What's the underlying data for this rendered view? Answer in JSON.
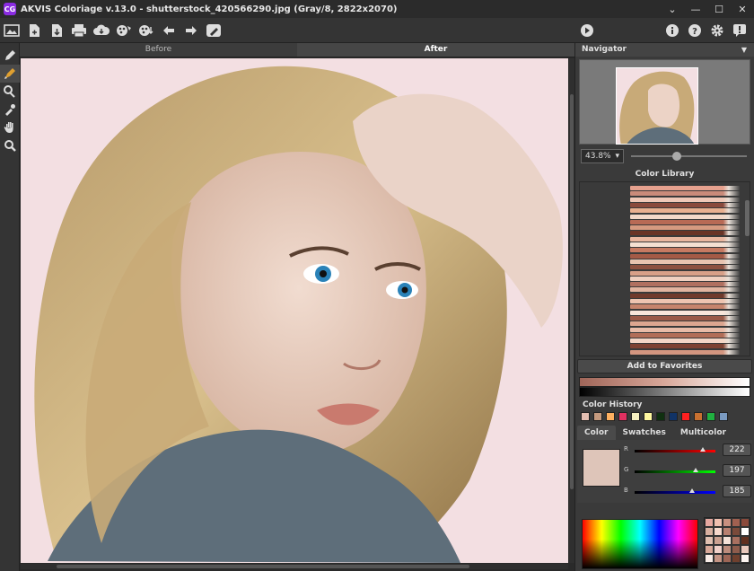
{
  "window": {
    "logo_text": "CG",
    "title": "AKVIS Coloriage v.13.0 - shutterstock_420566290.jpg (Gray/8, 2822x2070)",
    "controls": [
      "chevron-down-icon",
      "minimize-icon",
      "maximize-icon",
      "close-icon"
    ]
  },
  "toolbar": {
    "left_icons": [
      "home-icon",
      "open-file-icon",
      "save-icon",
      "print-icon",
      "share-cloud-icon",
      "paint-stroke-icon",
      "load-strokes-icon",
      "undo-icon",
      "redo-icon",
      "settings-brush-icon"
    ],
    "right_icons": [
      "run-icon",
      "info-icon",
      "help-icon",
      "settings-icon",
      "notification-icon"
    ]
  },
  "left_tools": [
    "pencil-icon",
    "color-brush-icon",
    "eraser-icon",
    "eyedropper-icon",
    "hand-icon",
    "zoom-icon"
  ],
  "canvas": {
    "tabs": [
      {
        "label": "Before",
        "active": false
      },
      {
        "label": "After",
        "active": true
      }
    ]
  },
  "navigator": {
    "title": "Navigator",
    "zoom": "43.8%"
  },
  "color_library": {
    "title": "Color Library",
    "pencil_colors": [
      "#e6a18e",
      "#c98b7a",
      "#f0c9b8",
      "#8a4a3c",
      "#e8b090",
      "#f2d8c8",
      "#b86a55",
      "#d69a80",
      "#6a3426",
      "#eab7a0",
      "#f5e0d2",
      "#c77a62",
      "#a45a46",
      "#e8c3b0",
      "#8c5040",
      "#d8a088",
      "#f0d0c0",
      "#b07060",
      "#e2b4a0",
      "#703a2c",
      "#eec4b0",
      "#c6846c",
      "#f8e6da",
      "#9a5a48",
      "#dca690",
      "#e9bca8",
      "#b26e58",
      "#f4d6c6",
      "#7e4232",
      "#d49680"
    ],
    "add_favorites": "Add to Favorites"
  },
  "color_history": {
    "title": "Color History",
    "colors": [
      "#e4bfb2",
      "#c59a7e",
      "#ffb060",
      "#e03060",
      "#f6f0c0",
      "#fff8a0",
      "#103010",
      "#113366",
      "#ff2020",
      "#c87030",
      "#20b040",
      "#7a9ac0"
    ]
  },
  "color_tabs": [
    {
      "label": "Color",
      "active": true
    },
    {
      "label": "Swatches",
      "active": false
    },
    {
      "label": "Multicolor",
      "active": false
    }
  ],
  "rgb": {
    "current_color": "#dec5b9",
    "r_label": "R",
    "g_label": "G",
    "b_label": "B",
    "r": "222",
    "g": "197",
    "b": "185",
    "r_value": 222,
    "g_value": 197,
    "b_value": 185
  },
  "mini_palette": [
    "#e6a8a0",
    "#f0c0b0",
    "#c89080",
    "#a06050",
    "#8a4a3c",
    "#d8b0a0",
    "#f6d8cc",
    "#b88070",
    "#7a4a3a",
    "#ffffff",
    "#e0c0b0",
    "#caa090",
    "#f4e2d8",
    "#a87060",
    "#603020",
    "#d8a898",
    "#f0d0c8",
    "#bc8c7c",
    "#8e5c4c",
    "#e8c8bc",
    "#f8ece6",
    "#c49484",
    "#9e6656",
    "#70402e",
    "#fcf4f0"
  ]
}
